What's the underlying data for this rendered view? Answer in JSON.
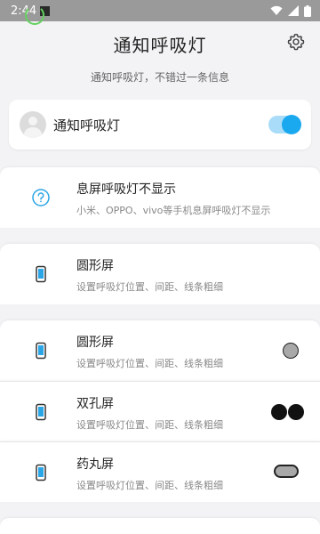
{
  "status_bar": {
    "time": "2:44"
  },
  "header": {
    "title": "通知呼吸灯",
    "subtitle": "通知呼吸灯，不错过一条信息"
  },
  "master": {
    "label": "通知呼吸灯",
    "enabled": true
  },
  "items": [
    {
      "title": "息屏呼吸灯不显示",
      "desc": "小米、OPPO、vivo等手机息屏呼吸灯不显示"
    },
    {
      "title": "圆形屏",
      "desc": "设置呼吸灯位置、间距、线条粗细"
    },
    {
      "title": "圆形屏",
      "desc": "设置呼吸灯位置、间距、线条粗细"
    },
    {
      "title": "双孔屏",
      "desc": "设置呼吸灯位置、间距、线条粗细"
    },
    {
      "title": "药丸屏",
      "desc": "设置呼吸灯位置、间距、线条粗细"
    }
  ],
  "colors": {
    "accent": "#1aa8ee",
    "toggle_track": "#a9dcf8",
    "background": "#f3f3f5"
  }
}
